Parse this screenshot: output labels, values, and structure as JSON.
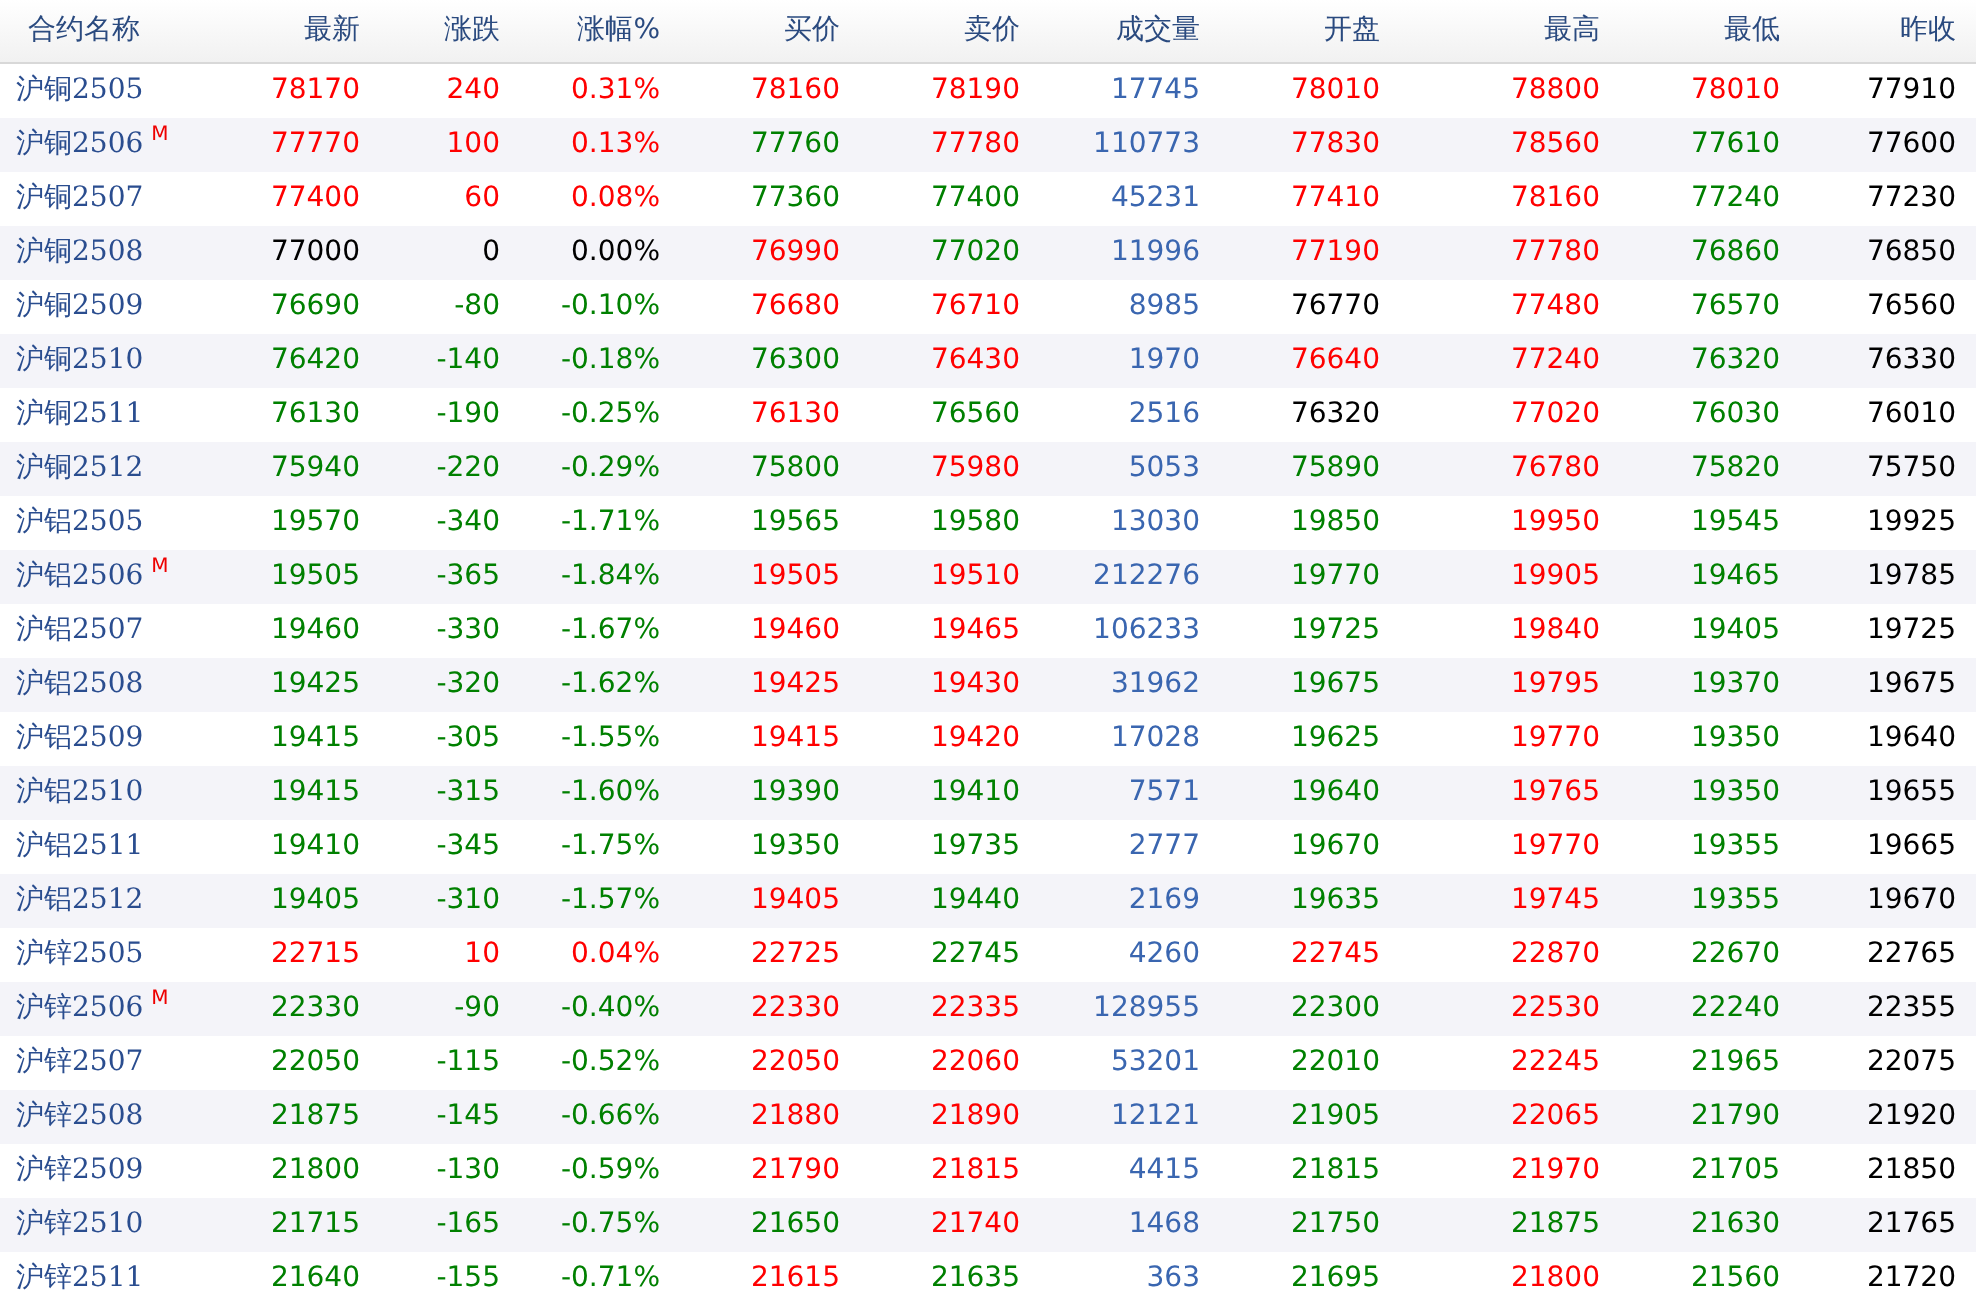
{
  "columns": [
    "合约名称",
    "最新",
    "涨跌",
    "涨幅%",
    "买价",
    "卖价",
    "成交量",
    "开盘",
    "最高",
    "最低",
    "昨收"
  ],
  "rows": [
    {
      "name": "沪铜2505",
      "main_mark": null,
      "quotes": [
        {
          "value": "78170",
          "color": "#ff0000"
        },
        {
          "value": "240",
          "color": "#ff0000"
        },
        {
          "value": "0.31%",
          "color": "#ff0000"
        },
        {
          "value": "78160",
          "color": "#ff0000"
        },
        {
          "value": "78190",
          "color": "#ff0000"
        },
        {
          "value": "78010",
          "color": "#ff0000"
        },
        {
          "value": "78800",
          "color": "#ff0000"
        },
        {
          "value": "78010",
          "color": "#ff0000"
        }
      ],
      "volume": "17745",
      "prev_close": "77910"
    },
    {
      "name": "沪铜2506",
      "main_mark": "M",
      "quotes": [
        {
          "value": "77770",
          "color": "#ff0000"
        },
        {
          "value": "100",
          "color": "#ff0000"
        },
        {
          "value": "0.13%",
          "color": "#ff0000"
        },
        {
          "value": "77760",
          "color": "#008000"
        },
        {
          "value": "77780",
          "color": "#ff0000"
        },
        {
          "value": "77830",
          "color": "#ff0000"
        },
        {
          "value": "78560",
          "color": "#ff0000"
        },
        {
          "value": "77610",
          "color": "#008000"
        }
      ],
      "volume": "110773",
      "prev_close": "77600"
    },
    {
      "name": "沪铜2507",
      "main_mark": null,
      "quotes": [
        {
          "value": "77400",
          "color": "#ff0000"
        },
        {
          "value": "60",
          "color": "#ff0000"
        },
        {
          "value": "0.08%",
          "color": "#ff0000"
        },
        {
          "value": "77360",
          "color": "#008000"
        },
        {
          "value": "77400",
          "color": "#008000"
        },
        {
          "value": "77410",
          "color": "#ff0000"
        },
        {
          "value": "78160",
          "color": "#ff0000"
        },
        {
          "value": "77240",
          "color": "#008000"
        }
      ],
      "volume": "45231",
      "prev_close": "77230"
    },
    {
      "name": "沪铜2508",
      "main_mark": null,
      "quotes": [
        {
          "value": "77000",
          "color": "#000000"
        },
        {
          "value": "0",
          "color": "#000000"
        },
        {
          "value": "0.00%",
          "color": "#000000"
        },
        {
          "value": "76990",
          "color": "#ff0000"
        },
        {
          "value": "77020",
          "color": "#008000"
        },
        {
          "value": "77190",
          "color": "#ff0000"
        },
        {
          "value": "77780",
          "color": "#ff0000"
        },
        {
          "value": "76860",
          "color": "#008000"
        }
      ],
      "volume": "11996",
      "prev_close": "76850"
    },
    {
      "name": "沪铜2509",
      "main_mark": null,
      "quotes": [
        {
          "value": "76690",
          "color": "#008000"
        },
        {
          "value": "-80",
          "color": "#008000"
        },
        {
          "value": "-0.10%",
          "color": "#008000"
        },
        {
          "value": "76680",
          "color": "#ff0000"
        },
        {
          "value": "76710",
          "color": "#ff0000"
        },
        {
          "value": "76770",
          "color": "#000000"
        },
        {
          "value": "77480",
          "color": "#ff0000"
        },
        {
          "value": "76570",
          "color": "#008000"
        }
      ],
      "volume": "8985",
      "prev_close": "76560"
    },
    {
      "name": "沪铜2510",
      "main_mark": null,
      "quotes": [
        {
          "value": "76420",
          "color": "#008000"
        },
        {
          "value": "-140",
          "color": "#008000"
        },
        {
          "value": "-0.18%",
          "color": "#008000"
        },
        {
          "value": "76300",
          "color": "#008000"
        },
        {
          "value": "76430",
          "color": "#ff0000"
        },
        {
          "value": "76640",
          "color": "#ff0000"
        },
        {
          "value": "77240",
          "color": "#ff0000"
        },
        {
          "value": "76320",
          "color": "#008000"
        }
      ],
      "volume": "1970",
      "prev_close": "76330"
    },
    {
      "name": "沪铜2511",
      "main_mark": null,
      "quotes": [
        {
          "value": "76130",
          "color": "#008000"
        },
        {
          "value": "-190",
          "color": "#008000"
        },
        {
          "value": "-0.25%",
          "color": "#008000"
        },
        {
          "value": "76130",
          "color": "#ff0000"
        },
        {
          "value": "76560",
          "color": "#008000"
        },
        {
          "value": "76320",
          "color": "#000000"
        },
        {
          "value": "77020",
          "color": "#ff0000"
        },
        {
          "value": "76030",
          "color": "#008000"
        }
      ],
      "volume": "2516",
      "prev_close": "76010"
    },
    {
      "name": "沪铜2512",
      "main_mark": null,
      "quotes": [
        {
          "value": "75940",
          "color": "#008000"
        },
        {
          "value": "-220",
          "color": "#008000"
        },
        {
          "value": "-0.29%",
          "color": "#008000"
        },
        {
          "value": "75800",
          "color": "#008000"
        },
        {
          "value": "75980",
          "color": "#ff0000"
        },
        {
          "value": "75890",
          "color": "#008000"
        },
        {
          "value": "76780",
          "color": "#ff0000"
        },
        {
          "value": "75820",
          "color": "#008000"
        }
      ],
      "volume": "5053",
      "prev_close": "75750"
    },
    {
      "name": "沪铝2505",
      "main_mark": null,
      "quotes": [
        {
          "value": "19570",
          "color": "#008000"
        },
        {
          "value": "-340",
          "color": "#008000"
        },
        {
          "value": "-1.71%",
          "color": "#008000"
        },
        {
          "value": "19565",
          "color": "#008000"
        },
        {
          "value": "19580",
          "color": "#008000"
        },
        {
          "value": "19850",
          "color": "#008000"
        },
        {
          "value": "19950",
          "color": "#ff0000"
        },
        {
          "value": "19545",
          "color": "#008000"
        }
      ],
      "volume": "13030",
      "prev_close": "19925"
    },
    {
      "name": "沪铝2506",
      "main_mark": "M",
      "quotes": [
        {
          "value": "19505",
          "color": "#008000"
        },
        {
          "value": "-365",
          "color": "#008000"
        },
        {
          "value": "-1.84%",
          "color": "#008000"
        },
        {
          "value": "19505",
          "color": "#ff0000"
        },
        {
          "value": "19510",
          "color": "#ff0000"
        },
        {
          "value": "19770",
          "color": "#008000"
        },
        {
          "value": "19905",
          "color": "#ff0000"
        },
        {
          "value": "19465",
          "color": "#008000"
        }
      ],
      "volume": "212276",
      "prev_close": "19785"
    },
    {
      "name": "沪铝2507",
      "main_mark": null,
      "quotes": [
        {
          "value": "19460",
          "color": "#008000"
        },
        {
          "value": "-330",
          "color": "#008000"
        },
        {
          "value": "-1.67%",
          "color": "#008000"
        },
        {
          "value": "19460",
          "color": "#ff0000"
        },
        {
          "value": "19465",
          "color": "#ff0000"
        },
        {
          "value": "19725",
          "color": "#008000"
        },
        {
          "value": "19840",
          "color": "#ff0000"
        },
        {
          "value": "19405",
          "color": "#008000"
        }
      ],
      "volume": "106233",
      "prev_close": "19725"
    },
    {
      "name": "沪铝2508",
      "main_mark": null,
      "quotes": [
        {
          "value": "19425",
          "color": "#008000"
        },
        {
          "value": "-320",
          "color": "#008000"
        },
        {
          "value": "-1.62%",
          "color": "#008000"
        },
        {
          "value": "19425",
          "color": "#ff0000"
        },
        {
          "value": "19430",
          "color": "#ff0000"
        },
        {
          "value": "19675",
          "color": "#008000"
        },
        {
          "value": "19795",
          "color": "#ff0000"
        },
        {
          "value": "19370",
          "color": "#008000"
        }
      ],
      "volume": "31962",
      "prev_close": "19675"
    },
    {
      "name": "沪铝2509",
      "main_mark": null,
      "quotes": [
        {
          "value": "19415",
          "color": "#008000"
        },
        {
          "value": "-305",
          "color": "#008000"
        },
        {
          "value": "-1.55%",
          "color": "#008000"
        },
        {
          "value": "19415",
          "color": "#ff0000"
        },
        {
          "value": "19420",
          "color": "#ff0000"
        },
        {
          "value": "19625",
          "color": "#008000"
        },
        {
          "value": "19770",
          "color": "#ff0000"
        },
        {
          "value": "19350",
          "color": "#008000"
        }
      ],
      "volume": "17028",
      "prev_close": "19640"
    },
    {
      "name": "沪铝2510",
      "main_mark": null,
      "quotes": [
        {
          "value": "19415",
          "color": "#008000"
        },
        {
          "value": "-315",
          "color": "#008000"
        },
        {
          "value": "-1.60%",
          "color": "#008000"
        },
        {
          "value": "19390",
          "color": "#008000"
        },
        {
          "value": "19410",
          "color": "#008000"
        },
        {
          "value": "19640",
          "color": "#008000"
        },
        {
          "value": "19765",
          "color": "#ff0000"
        },
        {
          "value": "19350",
          "color": "#008000"
        }
      ],
      "volume": "7571",
      "prev_close": "19655"
    },
    {
      "name": "沪铝2511",
      "main_mark": null,
      "quotes": [
        {
          "value": "19410",
          "color": "#008000"
        },
        {
          "value": "-345",
          "color": "#008000"
        },
        {
          "value": "-1.75%",
          "color": "#008000"
        },
        {
          "value": "19350",
          "color": "#008000"
        },
        {
          "value": "19735",
          "color": "#008000"
        },
        {
          "value": "19670",
          "color": "#008000"
        },
        {
          "value": "19770",
          "color": "#ff0000"
        },
        {
          "value": "19355",
          "color": "#008000"
        }
      ],
      "volume": "2777",
      "prev_close": "19665"
    },
    {
      "name": "沪铝2512",
      "main_mark": null,
      "quotes": [
        {
          "value": "19405",
          "color": "#008000"
        },
        {
          "value": "-310",
          "color": "#008000"
        },
        {
          "value": "-1.57%",
          "color": "#008000"
        },
        {
          "value": "19405",
          "color": "#ff0000"
        },
        {
          "value": "19440",
          "color": "#008000"
        },
        {
          "value": "19635",
          "color": "#008000"
        },
        {
          "value": "19745",
          "color": "#ff0000"
        },
        {
          "value": "19355",
          "color": "#008000"
        }
      ],
      "volume": "2169",
      "prev_close": "19670"
    },
    {
      "name": "沪锌2505",
      "main_mark": null,
      "quotes": [
        {
          "value": "22715",
          "color": "#ff0000"
        },
        {
          "value": "10",
          "color": "#ff0000"
        },
        {
          "value": "0.04%",
          "color": "#ff0000"
        },
        {
          "value": "22725",
          "color": "#ff0000"
        },
        {
          "value": "22745",
          "color": "#008000"
        },
        {
          "value": "22745",
          "color": "#ff0000"
        },
        {
          "value": "22870",
          "color": "#ff0000"
        },
        {
          "value": "22670",
          "color": "#008000"
        }
      ],
      "volume": "4260",
      "prev_close": "22765"
    },
    {
      "name": "沪锌2506",
      "main_mark": "M",
      "quotes": [
        {
          "value": "22330",
          "color": "#008000"
        },
        {
          "value": "-90",
          "color": "#008000"
        },
        {
          "value": "-0.40%",
          "color": "#008000"
        },
        {
          "value": "22330",
          "color": "#ff0000"
        },
        {
          "value": "22335",
          "color": "#ff0000"
        },
        {
          "value": "22300",
          "color": "#008000"
        },
        {
          "value": "22530",
          "color": "#ff0000"
        },
        {
          "value": "22240",
          "color": "#008000"
        }
      ],
      "volume": "128955",
      "prev_close": "22355"
    },
    {
      "name": "沪锌2507",
      "main_mark": null,
      "quotes": [
        {
          "value": "22050",
          "color": "#008000"
        },
        {
          "value": "-115",
          "color": "#008000"
        },
        {
          "value": "-0.52%",
          "color": "#008000"
        },
        {
          "value": "22050",
          "color": "#ff0000"
        },
        {
          "value": "22060",
          "color": "#ff0000"
        },
        {
          "value": "22010",
          "color": "#008000"
        },
        {
          "value": "22245",
          "color": "#ff0000"
        },
        {
          "value": "21965",
          "color": "#008000"
        }
      ],
      "volume": "53201",
      "prev_close": "22075"
    },
    {
      "name": "沪锌2508",
      "main_mark": null,
      "quotes": [
        {
          "value": "21875",
          "color": "#008000"
        },
        {
          "value": "-145",
          "color": "#008000"
        },
        {
          "value": "-0.66%",
          "color": "#008000"
        },
        {
          "value": "21880",
          "color": "#ff0000"
        },
        {
          "value": "21890",
          "color": "#ff0000"
        },
        {
          "value": "21905",
          "color": "#008000"
        },
        {
          "value": "22065",
          "color": "#ff0000"
        },
        {
          "value": "21790",
          "color": "#008000"
        }
      ],
      "volume": "12121",
      "prev_close": "21920"
    },
    {
      "name": "沪锌2509",
      "main_mark": null,
      "quotes": [
        {
          "value": "21800",
          "color": "#008000"
        },
        {
          "value": "-130",
          "color": "#008000"
        },
        {
          "value": "-0.59%",
          "color": "#008000"
        },
        {
          "value": "21790",
          "color": "#ff0000"
        },
        {
          "value": "21815",
          "color": "#ff0000"
        },
        {
          "value": "21815",
          "color": "#008000"
        },
        {
          "value": "21970",
          "color": "#ff0000"
        },
        {
          "value": "21705",
          "color": "#008000"
        }
      ],
      "volume": "4415",
      "prev_close": "21850"
    },
    {
      "name": "沪锌2510",
      "main_mark": null,
      "quotes": [
        {
          "value": "21715",
          "color": "#008000"
        },
        {
          "value": "-165",
          "color": "#008000"
        },
        {
          "value": "-0.75%",
          "color": "#008000"
        },
        {
          "value": "21650",
          "color": "#008000"
        },
        {
          "value": "21740",
          "color": "#ff0000"
        },
        {
          "value": "21750",
          "color": "#008000"
        },
        {
          "value": "21875",
          "color": "#008000"
        },
        {
          "value": "21630",
          "color": "#008000"
        }
      ],
      "volume": "1468",
      "prev_close": "21765"
    },
    {
      "name": "沪锌2511",
      "main_mark": null,
      "quotes": [
        {
          "value": "21640",
          "color": "#008000"
        },
        {
          "value": "-155",
          "color": "#008000"
        },
        {
          "value": "-0.71%",
          "color": "#008000"
        },
        {
          "value": "21615",
          "color": "#ff0000"
        },
        {
          "value": "21635",
          "color": "#008000"
        },
        {
          "value": "21695",
          "color": "#008000"
        },
        {
          "value": "21800",
          "color": "#ff0000"
        },
        {
          "value": "21560",
          "color": "#008000"
        }
      ],
      "volume": "363",
      "prev_close": "21720"
    }
  ]
}
